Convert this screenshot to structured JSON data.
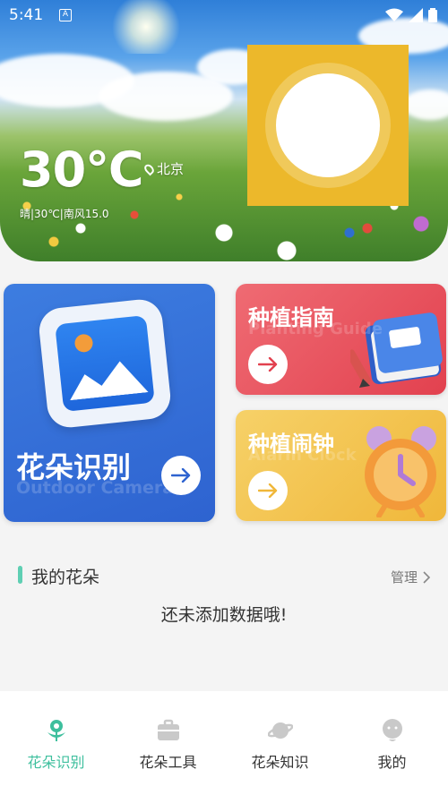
{
  "status_bar": {
    "time": "5:41",
    "app_icon_letter": "A"
  },
  "weather": {
    "temperature": "30℃",
    "location": "北京",
    "description": "晴|30℃|南风15.0"
  },
  "cards": {
    "flower_id": {
      "title": "花朵识别",
      "subtitle": "Outdoor Camera"
    },
    "guide": {
      "title": "种植指南",
      "subtitle": "Planting Guide"
    },
    "alarm": {
      "title": "种植闹钟",
      "subtitle": "Alarm Clock"
    }
  },
  "my_flowers": {
    "title": "我的花朵",
    "manage": "管理",
    "empty": "还未添加数据哦!"
  },
  "bottom_nav": {
    "items": [
      {
        "label": "花朵识别",
        "icon": "flower-icon",
        "active": true
      },
      {
        "label": "花朵工具",
        "icon": "toolbox-icon",
        "active": false
      },
      {
        "label": "花朵知识",
        "icon": "planet-icon",
        "active": false
      },
      {
        "label": "我的",
        "icon": "profile-icon",
        "active": false
      }
    ]
  },
  "colors": {
    "accent": "#3dbf9d",
    "card_blue": "#2e63d0",
    "card_red": "#e2414f",
    "card_yellow": "#f0b73a",
    "weather_icon": "#ecb82b"
  }
}
